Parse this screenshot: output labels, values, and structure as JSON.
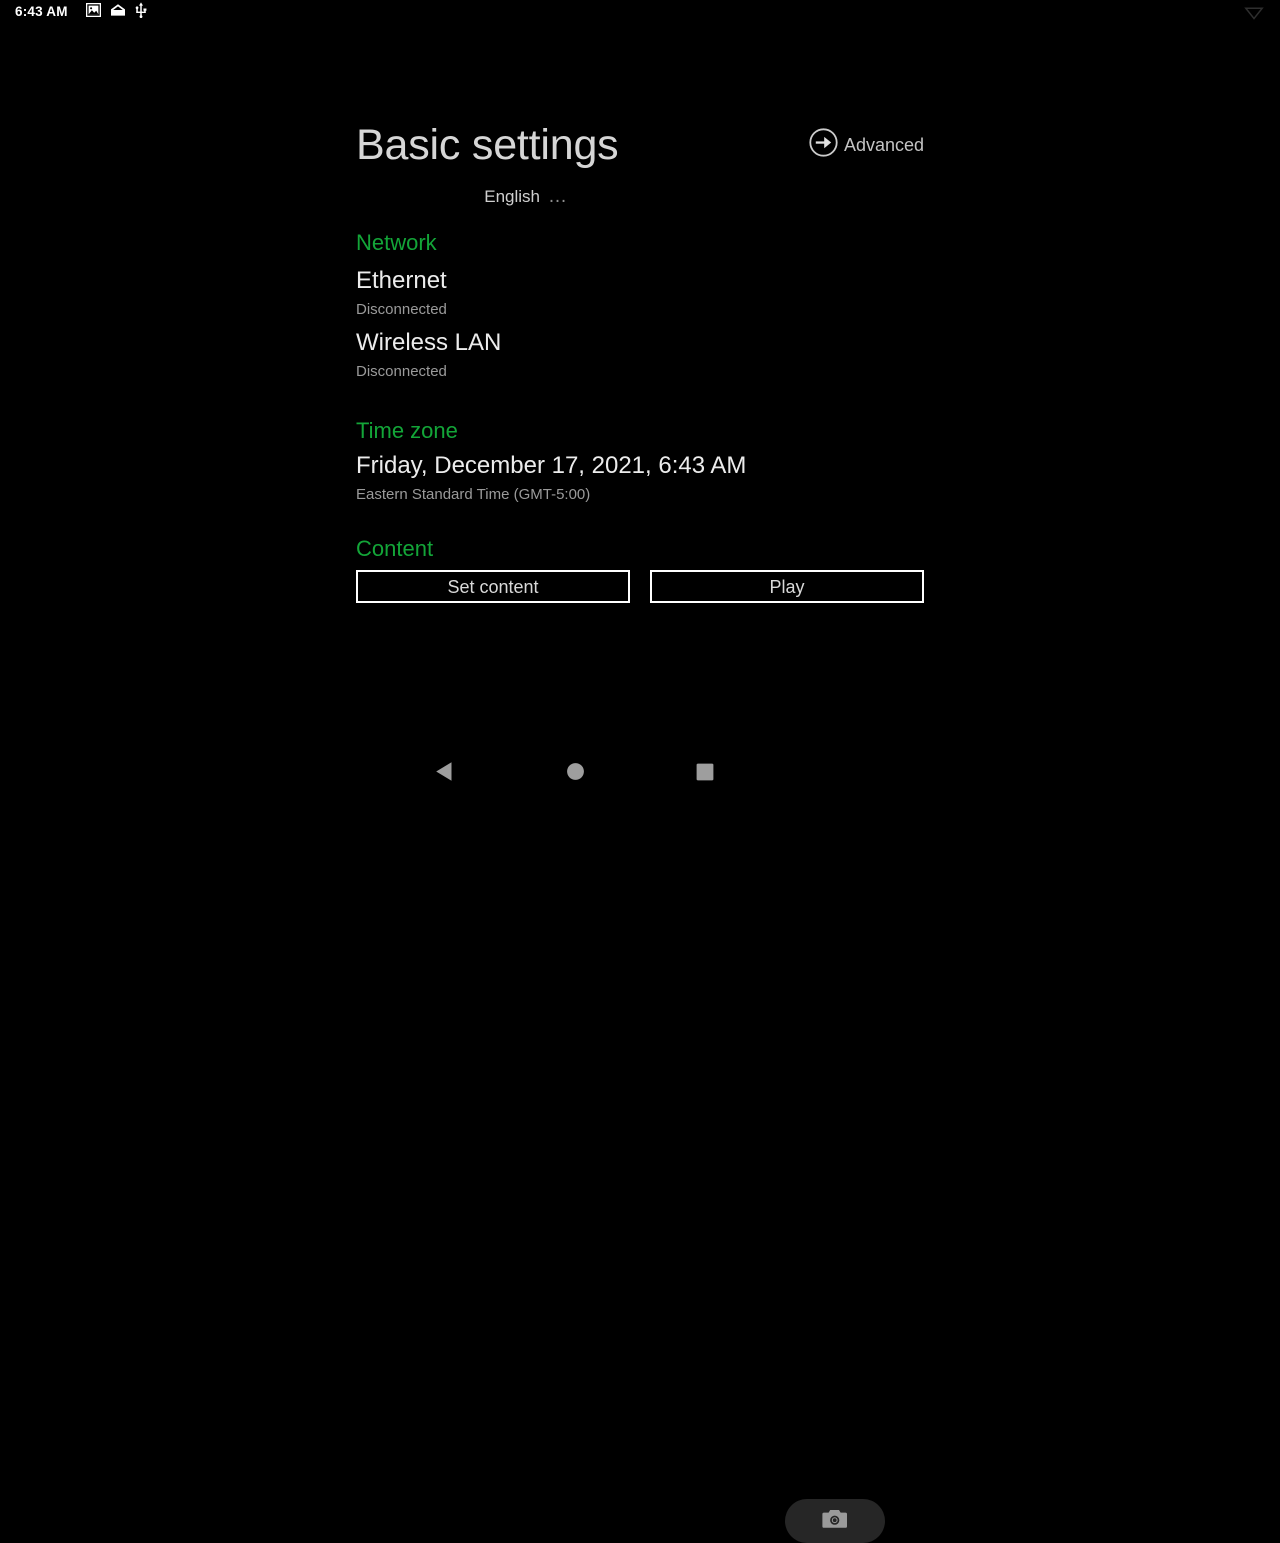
{
  "status_bar": {
    "clock": "6:43 AM",
    "icons": [
      {
        "name": "image-icon",
        "glyph": "image"
      },
      {
        "name": "screenshot-icon",
        "glyph": "screenshot"
      },
      {
        "name": "usb-icon",
        "glyph": "usb"
      }
    ],
    "right_icon": {
      "name": "wifi-disconnected-icon",
      "glyph": "wifi"
    }
  },
  "header": {
    "title": "Basic settings",
    "advanced_label": "Advanced",
    "advanced_icon": "arrow-right-circle-icon"
  },
  "language": {
    "value": "English",
    "more": "…"
  },
  "sections": {
    "network": {
      "title": "Network",
      "items": [
        {
          "name": "Ethernet",
          "status": "Disconnected"
        },
        {
          "name": "Wireless LAN",
          "status": "Disconnected"
        }
      ]
    },
    "time_zone": {
      "title": "Time zone",
      "datetime": "Friday, December 17, 2021, 6:43 AM",
      "zone": "Eastern Standard Time (GMT-5:00)"
    },
    "content": {
      "title": "Content",
      "buttons": [
        {
          "label": "Set content"
        },
        {
          "label": "Play"
        }
      ]
    }
  },
  "nav_bar": {
    "back_icon": "back-triangle-icon",
    "home_icon": "home-circle-icon",
    "recents_icon": "recents-square-icon",
    "screenshot_icon": "camera-icon"
  },
  "colors": {
    "background": "#000000",
    "accent_green": "#13a538",
    "primary_text": "#ececec",
    "secondary_text": "#9a9a9a",
    "button_border": "#ffffff"
  }
}
